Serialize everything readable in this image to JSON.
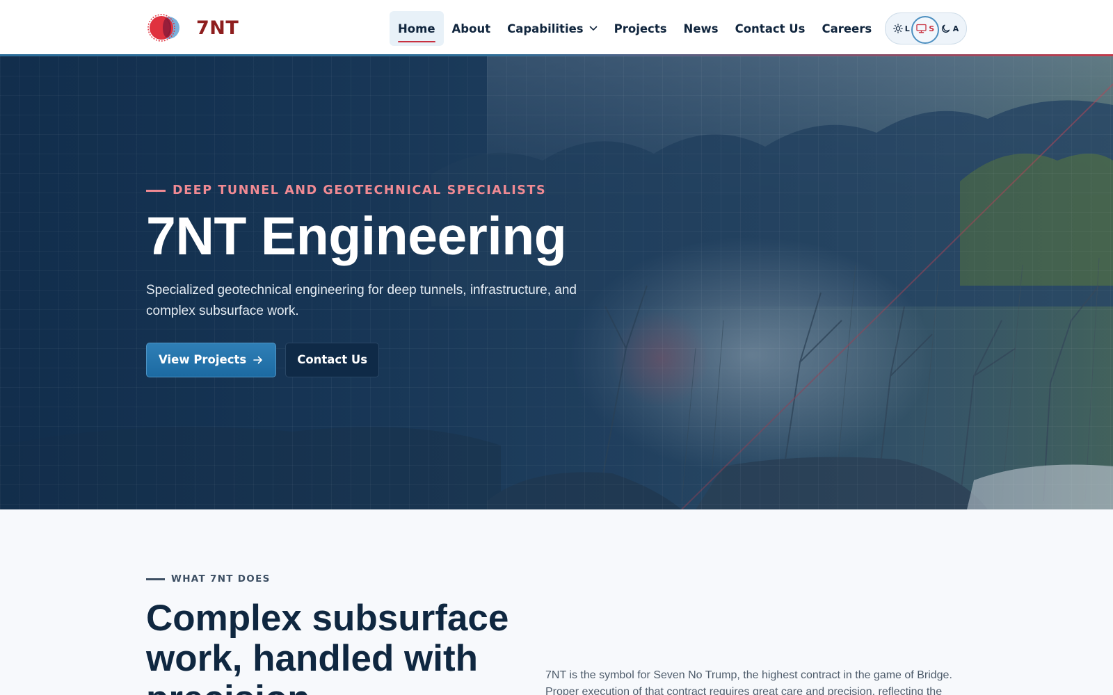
{
  "brand": {
    "name": "7NT",
    "colors": {
      "primary_navy": "#0f2740",
      "accent_red": "#c8303f",
      "accent_blue": "#1c6aa2",
      "eyebrow_pink": "#f08a93"
    }
  },
  "nav": {
    "items": [
      {
        "label": "Home",
        "active": true
      },
      {
        "label": "About"
      },
      {
        "label": "Capabilities",
        "has_dropdown": true
      },
      {
        "label": "Projects"
      },
      {
        "label": "News"
      },
      {
        "label": "Contact Us"
      },
      {
        "label": "Careers"
      }
    ]
  },
  "theme_toggle": {
    "options": [
      {
        "label": "L",
        "icon": "sun-icon"
      },
      {
        "label": "S",
        "icon": "monitor-icon",
        "active": true
      },
      {
        "label": "A",
        "icon": "moon-icon"
      }
    ]
  },
  "hero": {
    "eyebrow": "DEEP TUNNEL AND GEOTECHNICAL SPECIALISTS",
    "title": "7NT Engineering",
    "subtitle": "Specialized geotechnical engineering for deep tunnels, infrastructure, and complex subsurface work.",
    "primary_cta": "View Projects",
    "secondary_cta": "Contact Us"
  },
  "what_we_do": {
    "eyebrow": "WHAT 7NT DOES",
    "title": "Complex subsurface work, handled with precision",
    "body": "7NT is the symbol for Seven No Trump, the highest contract in the game of Bridge. Proper execution of that contract requires great care and precision, reflecting the way"
  }
}
